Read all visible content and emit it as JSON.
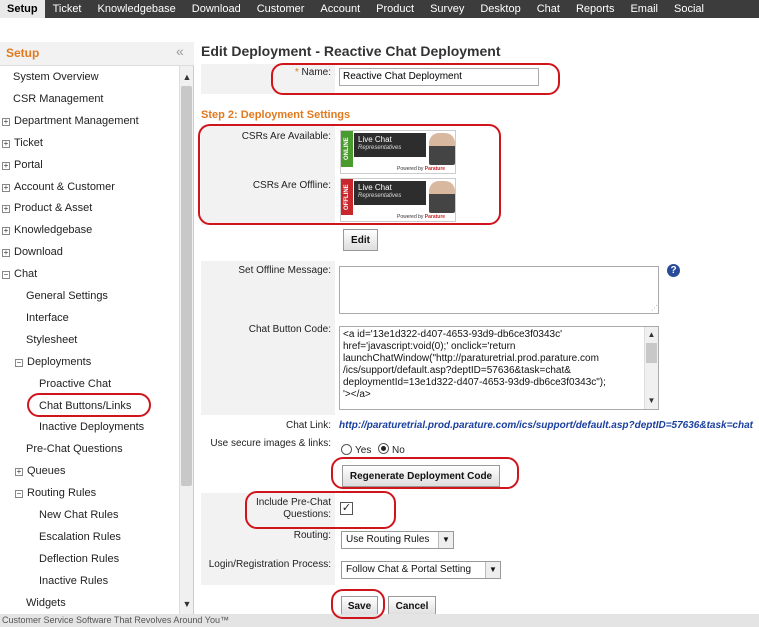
{
  "nav": {
    "tabs": [
      "Setup",
      "Ticket",
      "Knowledgebase",
      "Download",
      "Customer",
      "Account",
      "Product",
      "Survey",
      "Desktop",
      "Chat",
      "Reports",
      "Email",
      "Social"
    ]
  },
  "sidebar": {
    "title": "Setup",
    "collapse_glyph": "«",
    "items": [
      {
        "label": "System Overview",
        "level": 0,
        "expander": false
      },
      {
        "label": "CSR Management",
        "level": 0,
        "expander": false
      },
      {
        "label": "Department Management",
        "level": 0,
        "expander": true,
        "expanded": false
      },
      {
        "label": "Ticket",
        "level": 0,
        "expander": true,
        "expanded": false
      },
      {
        "label": "Portal",
        "level": 0,
        "expander": true,
        "expanded": false
      },
      {
        "label": "Account & Customer",
        "level": 0,
        "expander": true,
        "expanded": false
      },
      {
        "label": "Product & Asset",
        "level": 0,
        "expander": true,
        "expanded": false
      },
      {
        "label": "Knowledgebase",
        "level": 0,
        "expander": true,
        "expanded": false
      },
      {
        "label": "Download",
        "level": 0,
        "expander": true,
        "expanded": false
      },
      {
        "label": "Chat",
        "level": 0,
        "expander": true,
        "expanded": true
      },
      {
        "label": "General Settings",
        "level": 1,
        "expander": false
      },
      {
        "label": "Interface",
        "level": 1,
        "expander": false
      },
      {
        "label": "Stylesheet",
        "level": 1,
        "expander": false
      },
      {
        "label": "Deployments",
        "level": 1,
        "expander": true,
        "expanded": true
      },
      {
        "label": "Proactive Chat",
        "level": 2,
        "expander": false
      },
      {
        "label": "Chat Buttons/Links",
        "level": 2,
        "expander": false
      },
      {
        "label": "Inactive Deployments",
        "level": 2,
        "expander": false
      },
      {
        "label": "Pre-Chat Questions",
        "level": 1,
        "expander": false
      },
      {
        "label": "Queues",
        "level": 1,
        "expander": true,
        "expanded": false
      },
      {
        "label": "Routing Rules",
        "level": 1,
        "expander": true,
        "expanded": true
      },
      {
        "label": "New Chat Rules",
        "level": 2,
        "expander": false
      },
      {
        "label": "Escalation Rules",
        "level": 2,
        "expander": false
      },
      {
        "label": "Deflection Rules",
        "level": 2,
        "expander": false
      },
      {
        "label": "Inactive Rules",
        "level": 2,
        "expander": false
      },
      {
        "label": "Widgets",
        "level": 1,
        "expander": false
      }
    ]
  },
  "main": {
    "title": "Edit Deployment - Reactive Chat Deployment",
    "name_required_mark": "*",
    "name_label": "Name:",
    "name_value": "Reactive Chat Deployment",
    "step2_title": "Step 2: Deployment Settings",
    "csrs_available_label": "CSRs Are Available:",
    "csrs_offline_label": "CSRs Are Offline:",
    "badge_online": {
      "stripe": "ONLINE",
      "title": "Live Chat",
      "subtitle": "Representatives",
      "powered_by": "Powered by",
      "brand": "Parature"
    },
    "badge_offline": {
      "stripe": "OFFLINE",
      "title": "Live Chat",
      "subtitle": "Representatives",
      "powered_by": "Powered by",
      "brand": "Parature"
    },
    "edit_button": "Edit",
    "offline_message_label": "Set Offline Message:",
    "offline_message_value": "",
    "help_glyph": "?",
    "chat_button_code_label": "Chat Button Code:",
    "chat_button_code_lines": [
      "<a id='13e1d322-d407-4653-93d9-db6ce3f0343c'",
      "href='javascript:void(0);'  onclick='return",
      "launchChatWindow(\"http://paraturetrial.prod.parature.com",
      "/ics/support/default.asp?deptID=57636&task=chat&",
      "deploymentId=13e1d322-d407-4653-93d9-db6ce3f0343c\");",
      "'></a>"
    ],
    "chat_link_label": "Chat Link:",
    "chat_link_value": "http://paraturetrial.prod.parature.com/ics/support/default.asp?deptID=57636&task=chat",
    "secure_label": "Use secure images & links:",
    "secure_yes": "Yes",
    "secure_no": "No",
    "regenerate_button": "Regenerate Deployment Code",
    "include_prechat_label_1": "Include Pre-Chat",
    "include_prechat_label_2": "Questions:",
    "include_prechat_check": "✓",
    "routing_label": "Routing:",
    "routing_value": "Use Routing Rules",
    "login_label": "Login/Registration Process:",
    "login_value": "Follow Chat & Portal Setting",
    "save_button": "Save",
    "cancel_button": "Cancel"
  },
  "footer": {
    "text": "Customer Service Software That Revolves Around You™"
  },
  "colors": {
    "accent": "#e07a1f",
    "annotation": "#d0141c",
    "nav_bg": "#3c3c3c",
    "link": "#1a3f9e"
  }
}
